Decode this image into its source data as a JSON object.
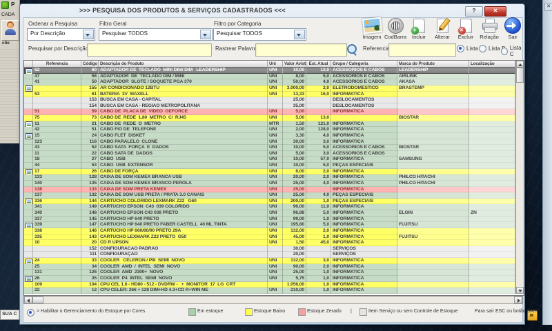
{
  "window": {
    "title": ">>>  PESQUISA DOS PRODUTOS & SERVIÇOS CADASTRADOS  <<<",
    "help_label": "?",
    "close_label": "✕"
  },
  "background": {
    "left_window_title": "P",
    "left_window_menu": "CADA",
    "left_window_button_caption": "clie",
    "bottom_left_label": "SUA C",
    "right_window_close": "✕"
  },
  "filters": {
    "ordenar_label": "Ordenar a Pesquisa",
    "ordenar_value": "Por Descrição",
    "filtro_geral_label": "Filtro Geral",
    "filtro_geral_value": "Pesquisar TODOS",
    "categoria_label": "Filtro por Categoria",
    "categoria_value": "Pesquisar TODOS"
  },
  "toolbar": {
    "buttons": [
      {
        "icon": "image-icon",
        "label": "Imagem"
      },
      {
        "icon": "barcode-icon",
        "label": "CodBarra"
      },
      {
        "icon": "add-document-icon",
        "label": "Incluir"
      },
      {
        "icon": "edit-pencil-icon",
        "label": "Alterar"
      },
      {
        "icon": "delete-document-icon",
        "label": "Excluir"
      },
      {
        "icon": "printer-icon",
        "label": "Relação"
      },
      {
        "icon": "exit-arrow-icon",
        "label": "Sair"
      }
    ]
  },
  "search": {
    "descricao_label": "Pesquisar por Descrição",
    "descricao_value": "",
    "rastrear_label": "Rastrear Palavras",
    "rastrear_value": "",
    "referencia_label": "Referencia",
    "referencia_value": "",
    "lists": [
      {
        "label": "Lista A",
        "selected": true
      },
      {
        "label": "Lista B",
        "selected": false
      },
      {
        "label": "Lista C",
        "selected": false
      }
    ]
  },
  "table": {
    "headers": [
      "Referencia",
      "Código",
      "Descrição do Produto",
      "Uni",
      "Valor Avista",
      "Est. Atual",
      "Grupo / Categoria",
      "Marca do Produto",
      "Localização"
    ],
    "rows": [
      {
        "ref": "52",
        "img": true,
        "cod": "60",
        "desc": "ADAPTADOR DE  TECLADO  MINI DIM/ DIM   LEADERSHIP",
        "uni": "UNI",
        "valor": "10,00",
        "est": "12,0",
        "grupo": "ACESSORIOS E CABOS",
        "marca": "LEADERSHIP",
        "loc": "",
        "status": "sel"
      },
      {
        "ref": "47",
        "cod": "56",
        "desc": "ADAPTADOR  DE  TECLADO DIM / MINI",
        "uni": "UNI",
        "valor": "8,00",
        "est": "5,0",
        "grupo": "ACESSORIOS E CABOS",
        "marca": "AIRLINK",
        "status": "g"
      },
      {
        "ref": "41",
        "cod": "50",
        "desc": "ADAPTADOR  SLOTE / SOQUETE PGA 370",
        "uni": "UNI",
        "valor": "50,00",
        "est": "4,0",
        "grupo": "ACESSORIOS E CABOS",
        "marca": "AKASA",
        "status": "g"
      },
      {
        "ref": "",
        "img": true,
        "cod": "155",
        "desc": "AR CONDICIONADO 12BTU",
        "uni": "UNI",
        "valor": "3.000,00",
        "est": "2,0",
        "grupo": "ELETRODOMESTICO",
        "marca": "BRASTEMP",
        "status": "y"
      },
      {
        "ref": "53",
        "cod": "61",
        "desc": "BATERIA  3V  MAXELL",
        "uni": "UNI",
        "valor": "13,33",
        "est": "16,0",
        "grupo": "INFORMATICA",
        "status": "y"
      },
      {
        "cod": "153",
        "desc": "BUSCA EM CASA - CAPITAL",
        "valor": "25,00",
        "grupo": "DESLOCAMENTOS",
        "status": "s"
      },
      {
        "cod": "154",
        "desc": "BUSCA EM CASA - REGIAO METROPOLITANA",
        "valor": "35,00",
        "grupo": "DESLOCAMENTOS",
        "status": "s"
      },
      {
        "ref": "51",
        "cod": "59",
        "desc": "CABO DE  PLACA DE  VIDEO  GEFORCE",
        "uni": "UNI",
        "valor": "5,00",
        "grupo": "INFORMATICA",
        "status": "p"
      },
      {
        "ref": "75",
        "cod": "73",
        "desc": "CABO DE  REDE  1,80  METRO  C/  RJ45",
        "uni": "UNI",
        "valor": "5,00",
        "est": "13,0",
        "marca": "BIOSTAR",
        "status": "y"
      },
      {
        "ref": "11",
        "img": true,
        "cod": "21",
        "desc": "CABO DE  REDE  O  METRO",
        "uni": "MTR",
        "valor": "1,50",
        "est": "121,0",
        "grupo": "INFORMATICA",
        "status": "g"
      },
      {
        "ref": "42",
        "cod": "51",
        "desc": "CABO FIO DE  TELEFONE",
        "uni": "UNI",
        "valor": "2,00",
        "est": "128,0",
        "grupo": "INFORMATICA",
        "status": "g"
      },
      {
        "ref": "15",
        "img": true,
        "cod": "24",
        "desc": "CABO FLET  DISKET",
        "uni": "UNI",
        "valor": "3,30",
        "est": "4,0",
        "grupo": "INFORMATICA",
        "status": "g"
      },
      {
        "ref": "123",
        "cod": "118",
        "desc": "CABO PARALELO  CLONE",
        "uni": "UNI",
        "valor": "30,00",
        "est": "3,0",
        "grupo": "INFORMATICA",
        "status": "g"
      },
      {
        "ref": "43",
        "cod": "52",
        "desc": "CABO SATA  FORÇA  E  DADOS",
        "uni": "UNI",
        "valor": "10,00",
        "est": "5,0",
        "grupo": "ACESSORIOS E CABOS",
        "marca": "BIOSTAR",
        "status": "g"
      },
      {
        "ref": "11",
        "cod": "22",
        "desc": "CABO SATA DE  DADOS",
        "uni": "UNI",
        "valor": "5,00",
        "est": "3,0",
        "grupo": "ACESSORIOS E CABOS",
        "status": "g"
      },
      {
        "ref": "18",
        "cod": "27",
        "desc": "CABO  USB",
        "uni": "UNI",
        "valor": "10,00",
        "est": "57,0",
        "grupo": "INFORMATICA",
        "marca": "SAMSUNG",
        "status": "g"
      },
      {
        "ref": "44",
        "cod": "53",
        "desc": "CABO  USB  EXTENSOR",
        "uni": "UNI",
        "valor": "10,00",
        "est": "5,0",
        "grupo": "PEÇAS ESPECIAIS",
        "status": "g"
      },
      {
        "ref": "17",
        "img": true,
        "cod": "26",
        "desc": "CABO DE FORÇA",
        "uni": "UNI",
        "valor": "6,00",
        "est": "2,0",
        "grupo": "INFORMATICA",
        "status": "y"
      },
      {
        "ref": "133",
        "cod": "128",
        "desc": "CAIXA DE SOM KEMEX BRANCA USB",
        "uni": "UNI",
        "valor": "20,00",
        "est": "2,0",
        "grupo": "INFORMATICA",
        "marca": "PHILCO HITACHI",
        "status": "g"
      },
      {
        "ref": "140",
        "cod": "135",
        "desc": "CAIXA DE SOM KEMEX BRANCO PEROLA",
        "uni": "UNI",
        "valor": "25,00",
        "est": "4,0",
        "grupo": "INFORMATICA",
        "marca": "PHILCO HITACHI",
        "status": "g"
      },
      {
        "ref": "138",
        "cod": "133",
        "desc": "CAIXA DE SOM PRETA KEMEX",
        "uni": "UNI",
        "valor": "25,00",
        "grupo": "INFORMATICA",
        "status": "p"
      },
      {
        "ref": "137",
        "cod": "132",
        "desc": "CAIXA DE SOM USB PRETA / PRATA 3.0 CANAIS",
        "uni": "UNI",
        "valor": "25,00",
        "est": "4,0",
        "grupo": "PEÇAS ESPECIAIS",
        "status": "g"
      },
      {
        "ref": "336",
        "img": true,
        "cod": "144",
        "desc": "CARTUCHO COLORIDO LEXMARK Z22   G60",
        "uni": "UNI",
        "valor": "200,00",
        "est": "1,0",
        "grupo": "PEÇAS ESPECIAIS",
        "status": "y"
      },
      {
        "ref": "341",
        "cod": "149",
        "desc": "CARTUCHO EPSON  C43  039 COLORIDO",
        "uni": "UNI",
        "valor": "96,00",
        "est": "11,0",
        "grupo": "INFORMATICA",
        "status": "g"
      },
      {
        "ref": "340",
        "cod": "148",
        "desc": "CARTUCHO EPSON C43 038 PRETO",
        "uni": "UNI",
        "valor": "96,88",
        "est": "5,0",
        "grupo": "INFORMATICA",
        "marca": "ELGIN",
        "loc": "ZN",
        "status": "g"
      },
      {
        "ref": "337",
        "cod": "145",
        "desc": "CARTUCHO HP 640 PRETO",
        "uni": "UNI",
        "valor": "99,00",
        "est": "1,0",
        "grupo": "INFORMATICA",
        "status": "g"
      },
      {
        "ref": "339",
        "img": true,
        "cod": "147",
        "desc": "CARTUCHO HP 640 PRETO FABER CASTELL  40 ML TINTA",
        "uni": "UNI",
        "valor": "195,80",
        "est": "5,0",
        "grupo": "INFORMATICA",
        "marca": "FUJITSU",
        "status": "g"
      },
      {
        "ref": "338",
        "cod": "146",
        "desc": "CARTUCHO HP 660/80/90 PRETO 29A",
        "uni": "UNI",
        "valor": "132,00",
        "est": "2,0",
        "grupo": "INFORMATICA",
        "status": "y"
      },
      {
        "ref": "335",
        "cod": "143",
        "desc": "CARTUCHO LEXMARK Z22 PRETO  G50",
        "uni": "UNI",
        "valor": "45,00",
        "est": "1,0",
        "grupo": "INFORMATICA",
        "marca": "FUJITSU",
        "status": "y"
      },
      {
        "ref": "10",
        "cod": "20",
        "desc": "CD R UPSON",
        "uni": "UNI",
        "valor": "1,50",
        "est": "45,0",
        "grupo": "INFORMATICA",
        "status": "y"
      },
      {
        "cod": "152",
        "desc": "CONFIGURACAO PADRAO",
        "valor": "30,00",
        "grupo": "SERVIÇOS",
        "status": "s"
      },
      {
        "cod": "111",
        "desc": "CONFIGURAÇÃO",
        "valor": "20,00",
        "grupo": "SERVIÇOS",
        "status": "s"
      },
      {
        "ref": "24",
        "img": true,
        "cod": "33",
        "desc": "COOLER   CELERON / PIII  SEMI  NOVO",
        "uni": "UNI",
        "valor": "132,00",
        "est": "3,0",
        "grupo": "INFORMATICA",
        "status": "y"
      },
      {
        "ref": "25",
        "cod": "34",
        "desc": "COOLER  AMD  /  INTEL  SEMI  NOVO",
        "uni": "UNI",
        "valor": "90,00",
        "est": "2,0",
        "grupo": "INFORMATICA",
        "status": "g"
      },
      {
        "ref": "131",
        "cod": "126",
        "desc": "COOLER  AMD  2300+  NOVO",
        "uni": "UNI",
        "valor": "25,00",
        "est": "1,0",
        "grupo": "INFORMATICA",
        "status": "g"
      },
      {
        "ref": "26",
        "img": true,
        "cod": "35",
        "desc": "COOLER  P4  INTEL  SEMI  NOVO",
        "uni": "UNI",
        "valor": "5,75",
        "est": "1,0",
        "grupo": "INFORMATICA",
        "status": "g"
      },
      {
        "ref": "109",
        "cod": "104",
        "desc": "CPU CEL 1.6 - HD80 - 512 - DVDRW -   +  MONITOR  17  LG  CRT",
        "valor": "1.056,00",
        "est": "1,0",
        "grupo": "INFORMATICA",
        "status": "y"
      },
      {
        "ref": "22",
        "cod": "12",
        "desc": "CPU CELER: 266 + 128 DIM+HD 4.3+CD R+WIN ME",
        "uni": "UNI",
        "valor": "210,00",
        "est": "1,0",
        "grupo": "INFORMATICA",
        "status": "g"
      }
    ]
  },
  "legend": {
    "toggle_label": "> Habilitar o Gerenciamento do Estoque por Cores",
    "items": [
      {
        "label": "Em estoque",
        "color": "#a9d1a9"
      },
      {
        "label": "Estoque Baixo",
        "color": "#ffff4f"
      },
      {
        "label": "Estoque Zerado",
        "color": "#f2a0a0"
      },
      {
        "label": "Item Serviço ou sem Controle de Estoque",
        "color": "#e4e4e4"
      }
    ],
    "separator": "|",
    "exit_hint": "Para sair ESC ou botão SAIR"
  }
}
